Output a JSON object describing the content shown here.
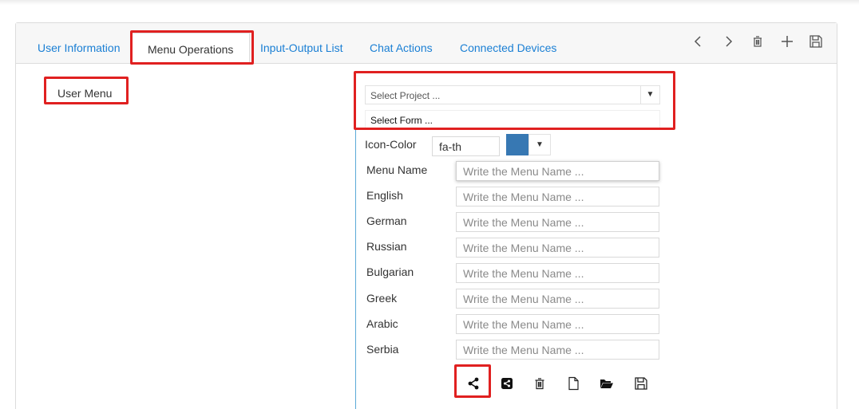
{
  "tabs": [
    {
      "label": "User Information",
      "active": false
    },
    {
      "label": "Menu Operations",
      "active": true
    },
    {
      "label": "Input-Output List",
      "active": false
    },
    {
      "label": "Chat Actions",
      "active": false
    },
    {
      "label": "Connected Devices",
      "active": false
    }
  ],
  "toolbar": {
    "icons": [
      "chevron-left-icon",
      "chevron-right-icon",
      "trash-icon",
      "plus-icon",
      "save-icon"
    ]
  },
  "tree": {
    "root_label": "User Menu"
  },
  "form": {
    "project_select": "Select Project ...",
    "form_select": "Select Form ...",
    "icon_color_label": "Icon-Color",
    "icon_value": "fa-th",
    "icon_color": "#3778b3",
    "placeholder": "Write the Menu Name ...",
    "fields": [
      {
        "label": "Menu Name"
      },
      {
        "label": "English"
      },
      {
        "label": "German"
      },
      {
        "label": "Russian"
      },
      {
        "label": "Bulgarian"
      },
      {
        "label": "Greek"
      },
      {
        "label": "Arabic"
      },
      {
        "label": "Serbia"
      }
    ]
  },
  "actions": [
    "share-icon",
    "share-square-icon",
    "trash-icon",
    "new-file-icon",
    "folder-open-icon",
    "save-icon"
  ],
  "accent_color": "#1a7fd4",
  "highlight_color": "#e02020"
}
